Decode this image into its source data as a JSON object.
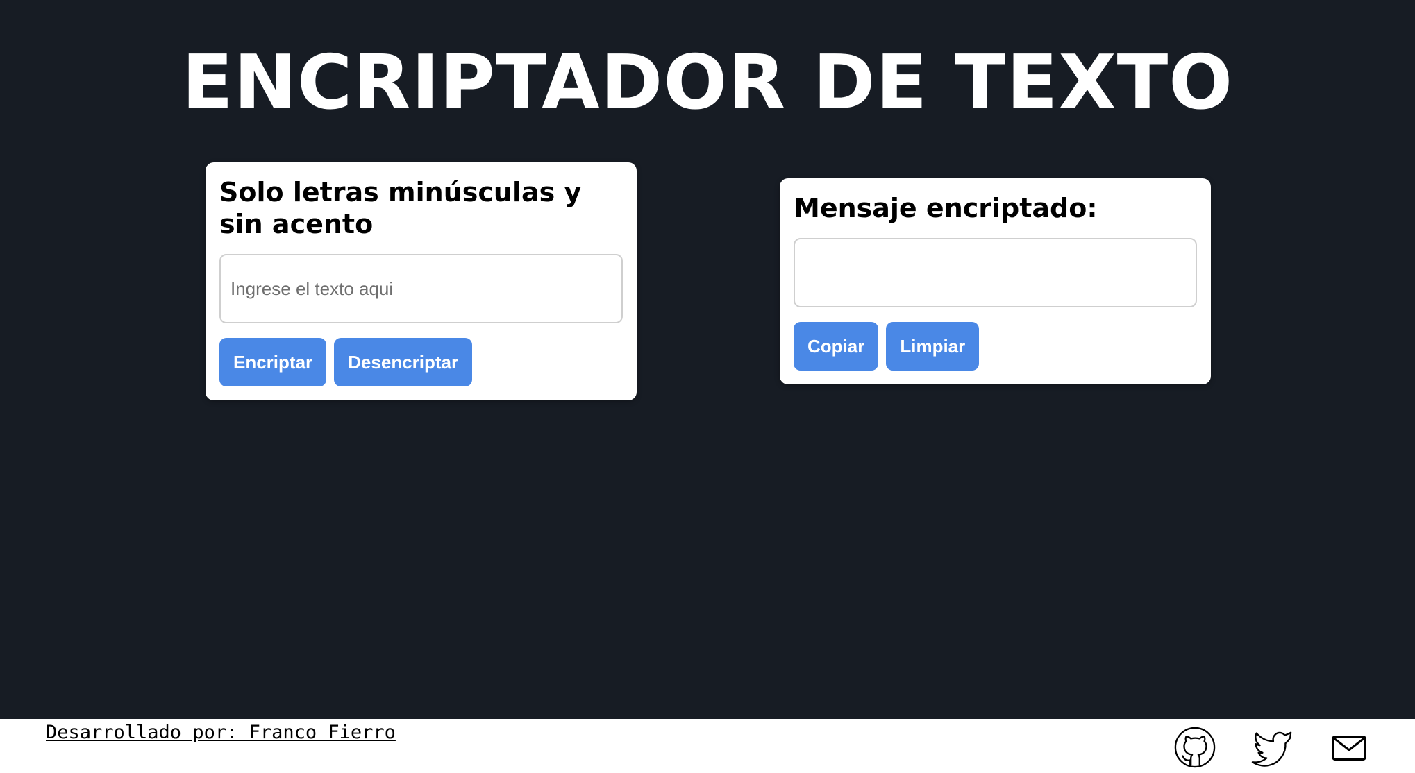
{
  "header": {
    "title": "ENCRIPTADOR DE TEXTO"
  },
  "input_card": {
    "heading": "Solo letras minúsculas y sin acento",
    "input_value": "",
    "input_placeholder": "Ingrese el texto aqui",
    "encrypt_label": "Encriptar",
    "decrypt_label": "Desencriptar"
  },
  "output_card": {
    "heading": "Mensaje encriptado:",
    "output_value": "",
    "copy_label": "Copiar",
    "clear_label": "Limpiar"
  },
  "footer": {
    "credit": "Desarrollado por: Franco Fierro",
    "icons": [
      "github-icon",
      "twitter-icon",
      "mail-icon"
    ]
  },
  "colors": {
    "background": "#171c24",
    "card": "#ffffff",
    "button": "#4a88e6",
    "footer": "#ffffff"
  }
}
